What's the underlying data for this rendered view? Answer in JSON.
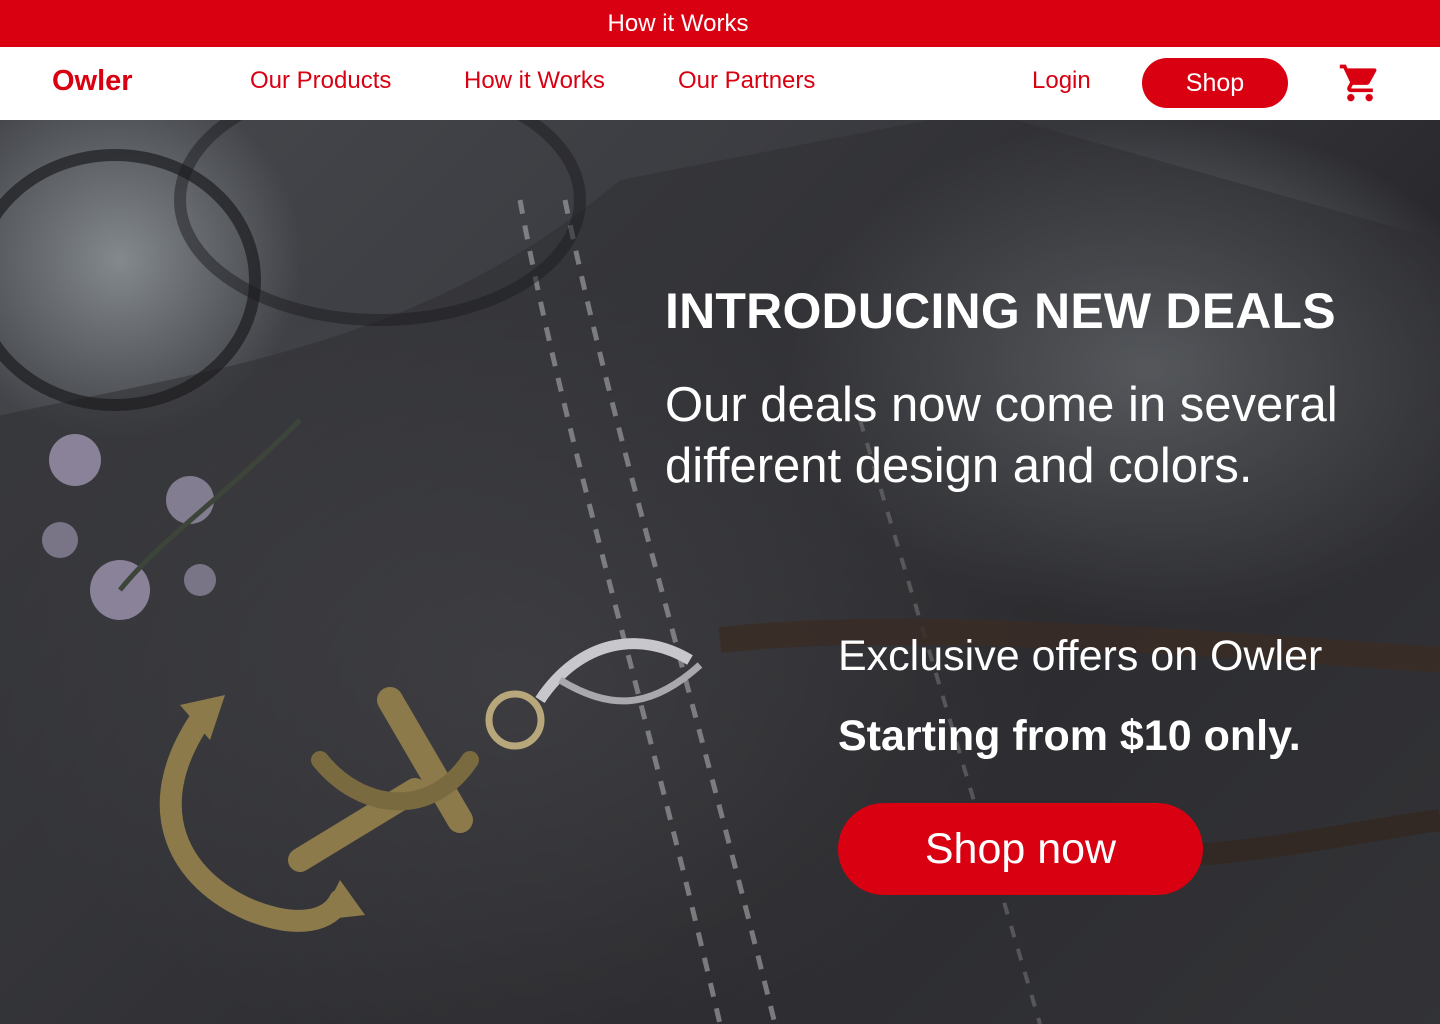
{
  "topbar": {
    "link_label": "How it Works"
  },
  "nav": {
    "brand": "Owler",
    "links": [
      {
        "label": "Our Products"
      },
      {
        "label": "How it Works"
      },
      {
        "label": "Our Partners"
      }
    ],
    "login_label": "Login",
    "shop_label": "Shop",
    "cart_icon": "shopping-cart-icon"
  },
  "hero": {
    "heading": "INTRODUCING NEW DEALS",
    "subheading": "Our deals now come in several different design and colors.",
    "offer_text": "Exclusive offers on Owler",
    "price_text": "Starting from $10 only.",
    "cta_label": "Shop now",
    "background_image": "leather-anchor-keychain-photo"
  },
  "colors": {
    "brand_red": "#d90012",
    "white": "#ffffff"
  }
}
